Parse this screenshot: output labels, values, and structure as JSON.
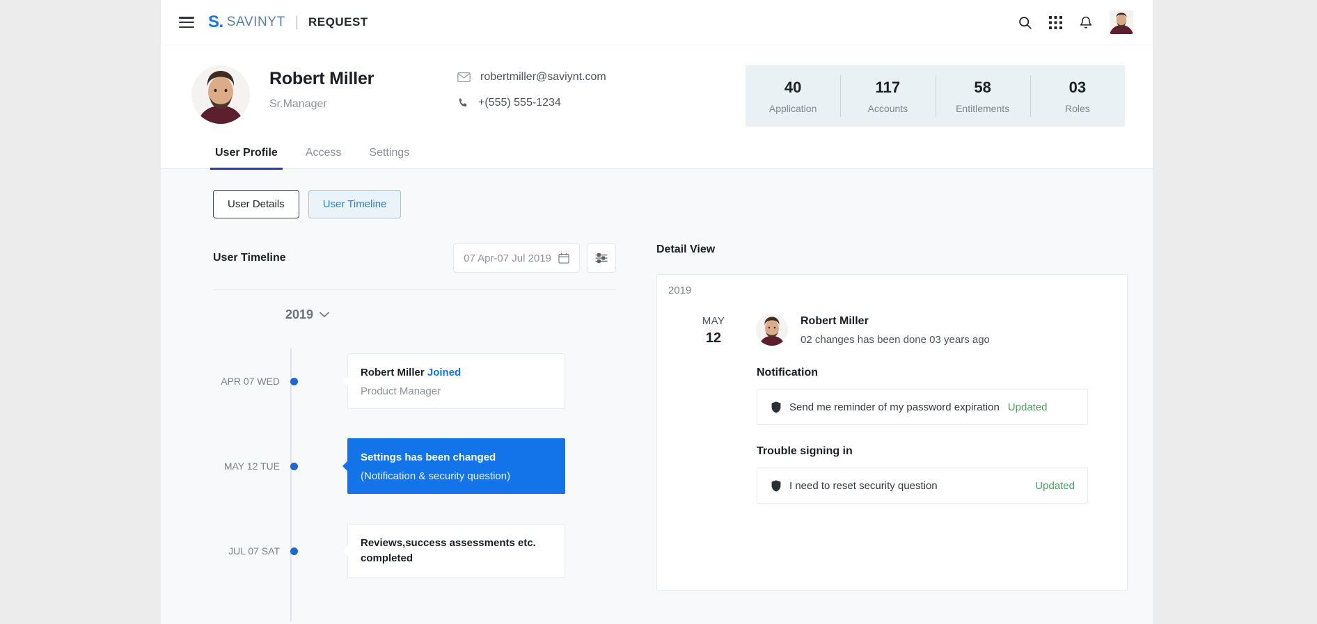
{
  "topbar": {
    "menu_icon": "hamburger-icon",
    "brand_mark": "S.",
    "brand_name": "SAVINYT",
    "separator": "|",
    "module": "REQUEST",
    "icons": [
      "search-icon",
      "apps-grid-icon",
      "bell-icon",
      "user-avatar"
    ]
  },
  "profile": {
    "name": "Robert Miller",
    "role": "Sr.Manager",
    "email": "robertmiller@saviynt.com",
    "phone": "+(555) 555-1234",
    "email_icon": "mail-icon",
    "phone_icon": "phone-icon",
    "stats": [
      {
        "value": "40",
        "label": "Application"
      },
      {
        "value": "117",
        "label": "Accounts"
      },
      {
        "value": "58",
        "label": "Entitlements"
      },
      {
        "value": "03",
        "label": "Roles"
      }
    ]
  },
  "tabs": [
    {
      "label": "User Profile",
      "active": true
    },
    {
      "label": "Access",
      "active": false
    },
    {
      "label": "Settings",
      "active": false
    }
  ],
  "subtabs": [
    {
      "label": "User Details",
      "selected": false
    },
    {
      "label": "User Timeline",
      "selected": true
    }
  ],
  "timeline": {
    "title": "User Timeline",
    "date_range": "07 Apr-07 Jul 2019",
    "calendar_icon": "calendar-icon",
    "filter_icon": "sliders-filter-icon",
    "year": "2019",
    "year_chevron": "chevron-down-icon",
    "events": [
      {
        "date": "APR 07 WED",
        "line1_main": "Robert Miller ",
        "line1_accent": "Joined",
        "line2": "Product Manager",
        "selected": false
      },
      {
        "date": "MAY 12 TUE",
        "line1_main": "Settings has been changed",
        "line1_accent": "",
        "line2": "(Notification & security question)",
        "selected": true
      },
      {
        "date": "JUL 07 SAT",
        "line1_main": "Reviews,success assessments etc. completed",
        "line1_accent": "",
        "line2": "",
        "selected": false
      }
    ]
  },
  "detail": {
    "title": "Detail View",
    "year": "2019",
    "month": "MAY",
    "day": "12",
    "person": "Robert Miller",
    "summary": "02 changes has been done 03 years ago",
    "sections": [
      {
        "title": "Notification",
        "rows": [
          {
            "icon": "shield-icon",
            "text": "Send me reminder of my password expiration",
            "status": "Updated"
          }
        ]
      },
      {
        "title": "Trouble signing in",
        "rows": [
          {
            "icon": "shield-icon",
            "text": "I need to reset security question",
            "status": "Updated"
          }
        ]
      }
    ]
  },
  "colors": {
    "brand_blue": "#1a73e8",
    "accent_blue": "#1274e8",
    "tab_underline": "#2b3ea8",
    "status_green": "#4f9b62",
    "stats_bg": "#eaf1f5"
  }
}
